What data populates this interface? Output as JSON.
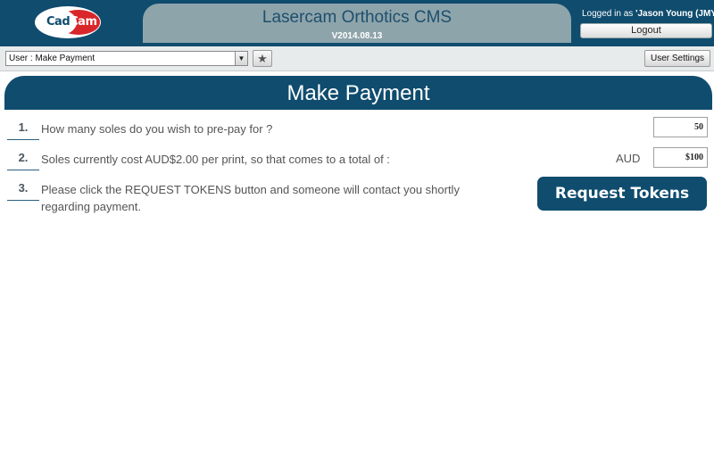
{
  "header": {
    "logo_left": "Cad",
    "logo_right": "Cam",
    "app_title": "Lasercam Orthotics CMS",
    "version": "V2014.08.13",
    "login_prefix": "Logged in as ",
    "login_user": "'Jason Young (JMY)'",
    "logout_label": "Logout"
  },
  "toolbar": {
    "page_select_value": "User : Make Payment",
    "settings_label": "User Settings"
  },
  "panel": {
    "title": "Make Payment"
  },
  "steps": [
    {
      "number": "1.",
      "text": "How many soles do you wish to pre-pay for ?"
    },
    {
      "number": "2.",
      "text": "Soles currently cost AUD$2.00 per print, so that comes to a total of :"
    },
    {
      "number": "3.",
      "text": "Please click the REQUEST TOKENS button and someone will contact you shortly regarding payment."
    }
  ],
  "form": {
    "quantity_value": "50",
    "currency_label": "AUD",
    "total_value": "$100",
    "request_label": "Request Tokens"
  },
  "colors": {
    "brand": "#0f4c6e",
    "title_tab": "#8ea4ab",
    "logo_accent": "#d9262b"
  }
}
